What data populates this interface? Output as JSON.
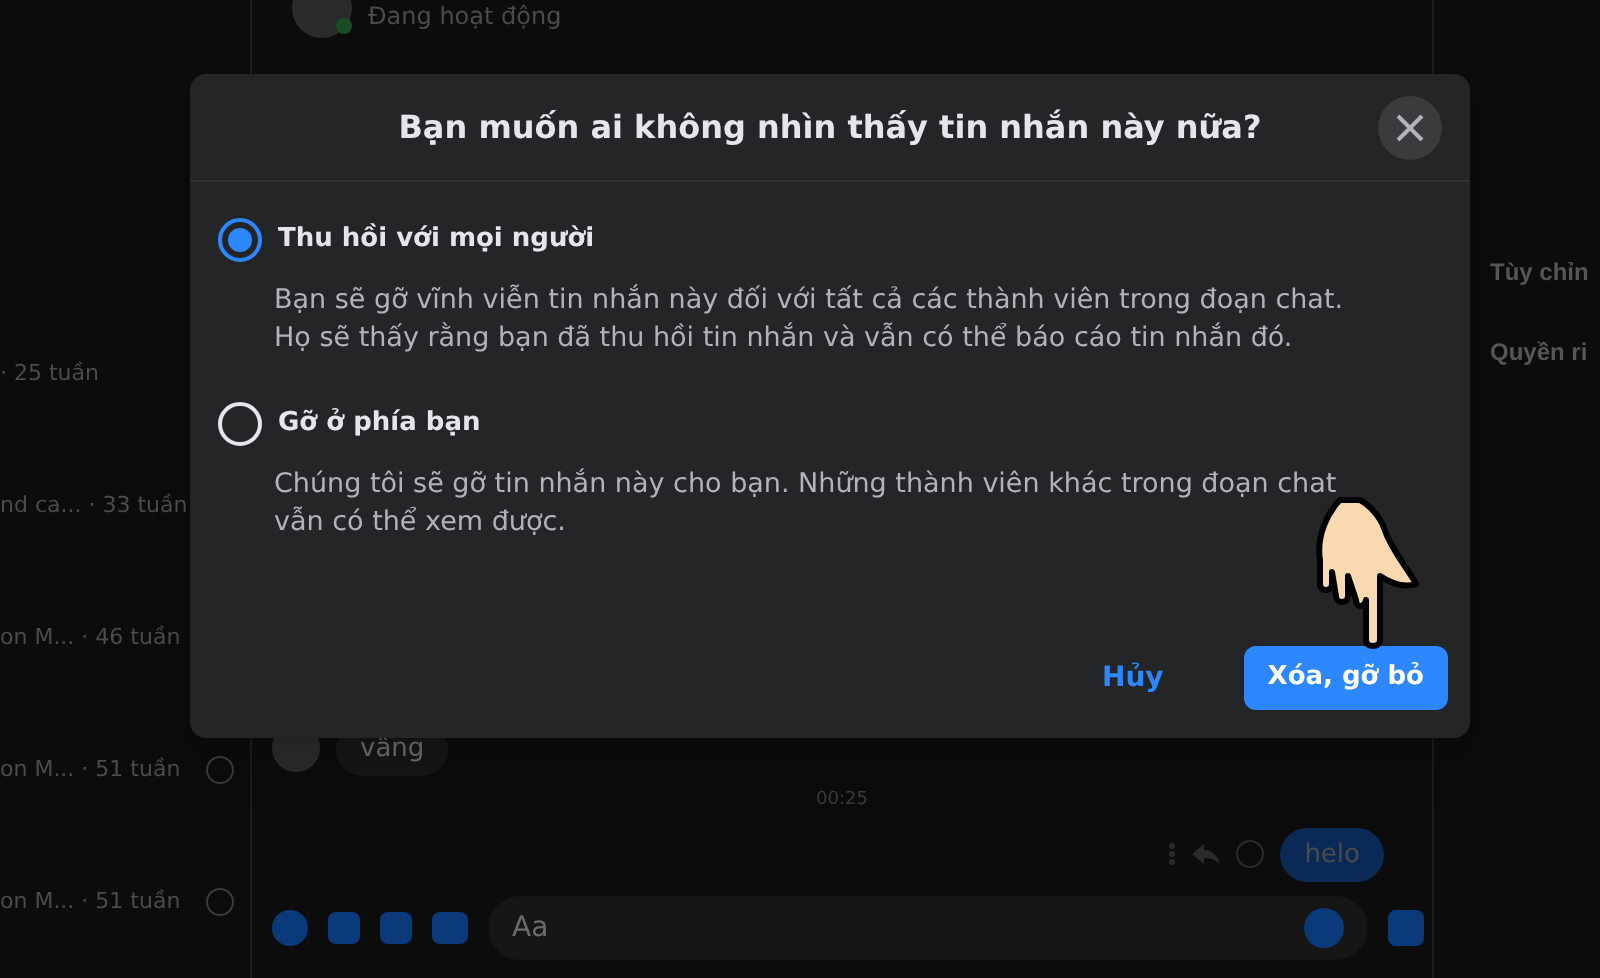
{
  "chat_header": {
    "status": "Đang hoạt động"
  },
  "sidebar": {
    "items": [
      {
        "preview": "· 25 tuần"
      },
      {
        "preview": "nd ca... · 33 tuần"
      },
      {
        "preview": "on M... · 46 tuần"
      },
      {
        "preview": "on M... · 51 tuần"
      },
      {
        "preview": "on M... · 51 tuần"
      }
    ]
  },
  "right_panel": {
    "items": [
      "Tùy chỉn",
      "Quyền ri"
    ]
  },
  "messages": [
    {
      "kind": "incoming",
      "text": "vâng"
    },
    {
      "kind": "time",
      "text": "00:25"
    },
    {
      "kind": "outgoing",
      "text": "helo"
    }
  ],
  "composer": {
    "placeholder": "Aa"
  },
  "dialog": {
    "title": "Bạn muốn ai không nhìn thấy tin nhắn này nữa?",
    "options": [
      {
        "label": "Thu hồi với mọi người",
        "description": "Bạn sẽ gỡ vĩnh viễn tin nhắn này đối với tất cả các thành viên trong đoạn chat.\nHọ sẽ thấy rằng bạn đã thu hồi tin nhắn và vẫn có thể báo cáo tin nhắn đó.",
        "selected": true
      },
      {
        "label": "Gỡ ở phía bạn",
        "description": "Chúng tôi sẽ gỡ tin nhắn này cho bạn. Những thành viên khác trong đoạn chat\nvẫn có thể xem được.",
        "selected": false
      }
    ],
    "cancel": "Hủy",
    "confirm": "Xóa, gỡ bỏ"
  }
}
